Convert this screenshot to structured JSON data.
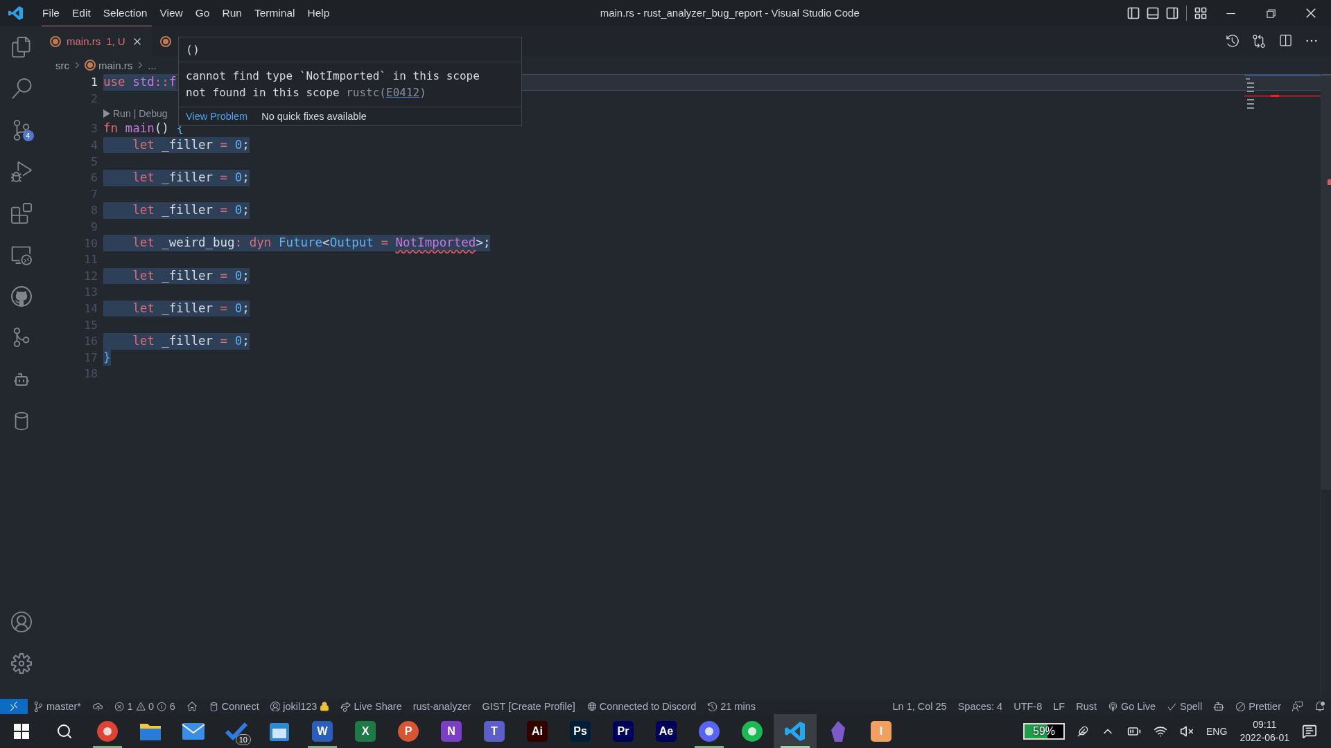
{
  "window": {
    "title": "main.rs - rust_analyzer_bug_report - Visual Studio Code"
  },
  "menu": [
    "File",
    "Edit",
    "Selection",
    "View",
    "Go",
    "Run",
    "Terminal",
    "Help"
  ],
  "activity_bar": {
    "top": [
      {
        "kind": "files",
        "selected": false
      },
      {
        "kind": "search",
        "selected": false
      },
      {
        "kind": "scm",
        "selected": false,
        "badge": "4"
      },
      {
        "kind": "debug",
        "selected": false
      },
      {
        "kind": "extensions",
        "selected": false
      },
      {
        "kind": "remote",
        "selected": false
      },
      {
        "kind": "github",
        "selected": false
      },
      {
        "kind": "graph",
        "selected": false
      },
      {
        "kind": "robot",
        "selected": false
      },
      {
        "kind": "database",
        "selected": false
      }
    ],
    "bottom": [
      {
        "kind": "account",
        "selected": false
      },
      {
        "kind": "settings",
        "selected": false
      }
    ]
  },
  "tabs": [
    {
      "label": "main.rs",
      "status": "1, U",
      "selected": true
    },
    {
      "selected": false
    }
  ],
  "breadcrumb": [
    "src",
    "main.rs",
    "..."
  ],
  "hover": {
    "signature": "()",
    "message": "cannot find type `NotImported` in this scope\nnot found in this scope",
    "source": "rustc(",
    "code": "E0412",
    "source_end": ")",
    "actions": [
      {
        "label": "View Problem",
        "kind": "link"
      },
      {
        "label": "No quick fixes available",
        "kind": "text"
      }
    ]
  },
  "lines": [
    {
      "number": "1",
      "current": true,
      "highlighted": true,
      "tokens": [
        {
          "text": "use ",
          "kind": "keyword"
        },
        {
          "text": "std",
          "kind": "module"
        },
        {
          "text": "::",
          "kind": "op"
        },
        {
          "text": "f",
          "kind": "module"
        }
      ]
    },
    {
      "number": "2",
      "current": false,
      "highlighted": false
    },
    {
      "number": "3",
      "current": false,
      "highlighted": false,
      "codelens": {
        "links": [
          "Run",
          "Debug"
        ],
        "separator": "|"
      },
      "tokens": [
        {
          "text": "fn ",
          "kind": "keyword"
        },
        {
          "text": "main",
          "kind": "module"
        },
        {
          "text": "() ",
          "kind": "plain"
        },
        {
          "text": "{",
          "kind": "brace"
        }
      ]
    },
    {
      "number": "4",
      "current": false,
      "highlighted": true,
      "tokens": [
        {
          "text": "    let ",
          "kind": "keyword"
        },
        {
          "text": "_filler ",
          "kind": "plain"
        },
        {
          "text": "= ",
          "kind": "op"
        },
        {
          "text": "0",
          "kind": "number"
        },
        {
          "text": ";",
          "kind": "plain"
        }
      ]
    },
    {
      "number": "5",
      "current": false,
      "highlighted": false
    },
    {
      "number": "6",
      "current": false,
      "highlighted": true,
      "tokens": [
        {
          "text": "    let ",
          "kind": "keyword"
        },
        {
          "text": "_filler ",
          "kind": "plain"
        },
        {
          "text": "= ",
          "kind": "op"
        },
        {
          "text": "0",
          "kind": "number"
        },
        {
          "text": ";",
          "kind": "plain"
        }
      ]
    },
    {
      "number": "7",
      "current": false,
      "highlighted": false
    },
    {
      "number": "8",
      "current": false,
      "highlighted": true,
      "tokens": [
        {
          "text": "    let ",
          "kind": "keyword"
        },
        {
          "text": "_filler ",
          "kind": "plain"
        },
        {
          "text": "= ",
          "kind": "op"
        },
        {
          "text": "0",
          "kind": "number"
        },
        {
          "text": ";",
          "kind": "plain"
        }
      ]
    },
    {
      "number": "9",
      "current": false,
      "highlighted": false
    },
    {
      "number": "10",
      "current": false,
      "highlighted": true,
      "tokens": [
        {
          "text": "    let ",
          "kind": "keyword"
        },
        {
          "text": "_weird_bug",
          "kind": "plain"
        },
        {
          "text": ": ",
          "kind": "op"
        },
        {
          "text": "dyn ",
          "kind": "keyword"
        },
        {
          "text": "Future",
          "kind": "type"
        },
        {
          "text": "<",
          "kind": "plain"
        },
        {
          "text": "Output ",
          "kind": "type"
        },
        {
          "text": "= ",
          "kind": "op"
        },
        {
          "text": "NotImported",
          "kind": "error"
        },
        {
          "text": ">;",
          "kind": "plain"
        }
      ]
    },
    {
      "number": "11",
      "current": false,
      "highlighted": false
    },
    {
      "number": "12",
      "current": false,
      "highlighted": true,
      "tokens": [
        {
          "text": "    let ",
          "kind": "keyword"
        },
        {
          "text": "_filler ",
          "kind": "plain"
        },
        {
          "text": "= ",
          "kind": "op"
        },
        {
          "text": "0",
          "kind": "number"
        },
        {
          "text": ";",
          "kind": "plain"
        }
      ]
    },
    {
      "number": "13",
      "current": false,
      "highlighted": false
    },
    {
      "number": "14",
      "current": false,
      "highlighted": true,
      "tokens": [
        {
          "text": "    let ",
          "kind": "keyword"
        },
        {
          "text": "_filler ",
          "kind": "plain"
        },
        {
          "text": "= ",
          "kind": "op"
        },
        {
          "text": "0",
          "kind": "number"
        },
        {
          "text": ";",
          "kind": "plain"
        }
      ]
    },
    {
      "number": "15",
      "current": false,
      "highlighted": false
    },
    {
      "number": "16",
      "current": false,
      "highlighted": true,
      "tokens": [
        {
          "text": "    let ",
          "kind": "keyword"
        },
        {
          "text": "_filler ",
          "kind": "plain"
        },
        {
          "text": "= ",
          "kind": "op"
        },
        {
          "text": "0",
          "kind": "number"
        },
        {
          "text": ";",
          "kind": "plain"
        }
      ]
    },
    {
      "number": "17",
      "current": false,
      "highlighted": true,
      "tokens": [
        {
          "text": "}",
          "kind": "brace"
        }
      ]
    },
    {
      "number": "18",
      "current": false,
      "highlighted": false
    }
  ],
  "status_bar": {
    "left": [
      {
        "kind": "remote"
      },
      {
        "kind": "branch",
        "text": "master*"
      },
      {
        "kind": "sync"
      },
      {
        "kind": "problems",
        "errors": "1",
        "warnings": "0",
        "infos": "6"
      },
      {
        "kind": "home"
      },
      {
        "kind": "database",
        "text": "Connect"
      },
      {
        "kind": "account",
        "text": "jokil123"
      },
      {
        "kind": "liveshare",
        "text": "Live Share"
      },
      {
        "kind": "plain",
        "text": "rust-analyzer"
      },
      {
        "kind": "plain",
        "text": "GIST [Create Profile]"
      },
      {
        "kind": "globe",
        "text": "Connected to Discord"
      },
      {
        "kind": "history",
        "text": "21 mins"
      }
    ],
    "right": [
      {
        "kind": "plain",
        "text": "Ln 1, Col 25"
      },
      {
        "kind": "plain",
        "text": "Spaces: 4"
      },
      {
        "kind": "plain",
        "text": "UTF-8"
      },
      {
        "kind": "plain",
        "text": "LF"
      },
      {
        "kind": "plain",
        "text": "Rust"
      },
      {
        "kind": "broadcast",
        "text": "Go Live"
      },
      {
        "kind": "check",
        "text": "Spell"
      },
      {
        "kind": "robot"
      },
      {
        "kind": "slash",
        "text": "Prettier"
      },
      {
        "kind": "feedback"
      },
      {
        "kind": "bell"
      }
    ]
  },
  "taskbar": {
    "apps": [
      {
        "kind": "round",
        "color": "#db4437",
        "running": true,
        "selected": false
      },
      {
        "kind": "folder",
        "color": "#f4c542",
        "running": false,
        "selected": false
      },
      {
        "kind": "mail",
        "color": "#3a8ee6",
        "running": false,
        "selected": false
      },
      {
        "kind": "check",
        "color": "#2f7be5",
        "running": false,
        "selected": false,
        "badge": "10"
      },
      {
        "kind": "calendar",
        "color": "#2a8ad4",
        "running": false,
        "selected": false
      },
      {
        "kind": "tile",
        "color": "#2b5eb8",
        "glyph": "W",
        "running": true,
        "selected": false
      },
      {
        "kind": "tile",
        "color": "#1d7a45",
        "glyph": "X",
        "running": false,
        "selected": false
      },
      {
        "kind": "roundglyph",
        "color": "#d65532",
        "glyph": "P",
        "running": false,
        "selected": false
      },
      {
        "kind": "tile",
        "color": "#7b3fc4",
        "glyph": "N",
        "running": false,
        "selected": false
      },
      {
        "kind": "tile",
        "color": "#5b5fc7",
        "glyph": "T",
        "running": false,
        "selected": false
      },
      {
        "kind": "tile",
        "color": "#330000",
        "glyph": "Ai",
        "running": false,
        "selected": false
      },
      {
        "kind": "tile",
        "color": "#001e36",
        "glyph": "Ps",
        "running": false,
        "selected": false
      },
      {
        "kind": "tile",
        "color": "#00005b",
        "glyph": "Pr",
        "running": false,
        "selected": false
      },
      {
        "kind": "tile",
        "color": "#00005b",
        "glyph": "Ae",
        "running": false,
        "selected": false
      },
      {
        "kind": "round",
        "color": "#5865f2",
        "running": true,
        "selected": false
      },
      {
        "kind": "round",
        "color": "#1db954",
        "running": false,
        "selected": false
      },
      {
        "kind": "code",
        "color": "#23a9f2",
        "running": true,
        "selected": true
      },
      {
        "kind": "gem",
        "color": "#7c5ac7",
        "running": false,
        "selected": false
      },
      {
        "kind": "tile",
        "color": "#f0a060",
        "glyph": "I",
        "running": false,
        "selected": false
      }
    ],
    "battery": {
      "reading": "59%",
      "level": 0.59
    },
    "language": "ENG",
    "time": "09:11",
    "date": "2022-06-01"
  }
}
